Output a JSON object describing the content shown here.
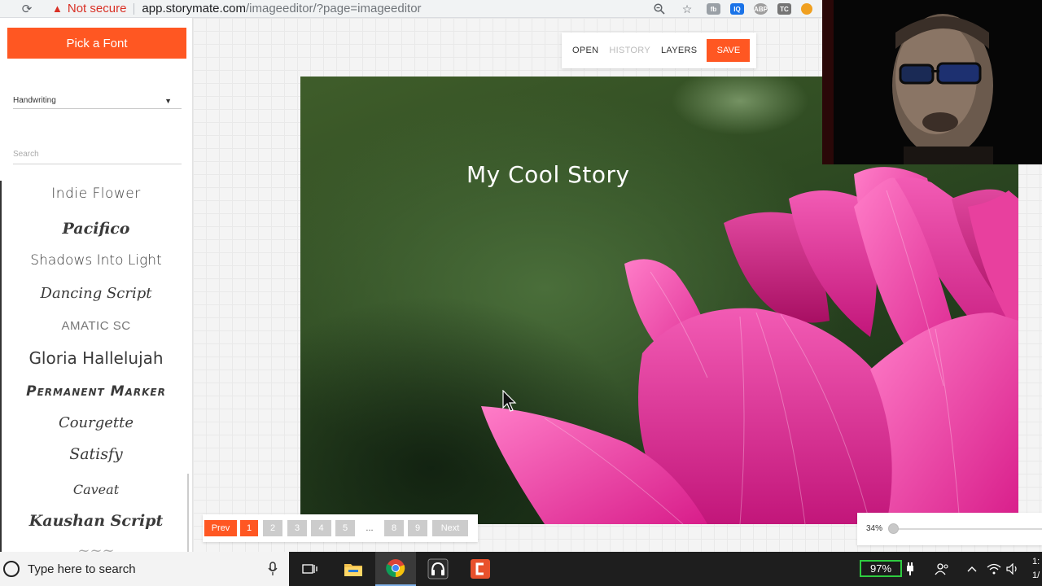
{
  "browser": {
    "security_label": "Not secure",
    "url_host": "app.storymate.com",
    "url_path": "/imageeditor/?page=imageeditor",
    "extensions": [
      "fb",
      "IQ",
      "ABP",
      "TC"
    ]
  },
  "sidebar": {
    "pick_font_label": "Pick a Font",
    "category_value": "Handwriting",
    "search_placeholder": "Search",
    "fonts": [
      {
        "label": "Indie Flower"
      },
      {
        "label": "Pacifico"
      },
      {
        "label": "Shadows Into Light"
      },
      {
        "label": "Dancing Script"
      },
      {
        "label": "AMATIC SC"
      },
      {
        "label": "Gloria Hallelujah"
      },
      {
        "label": "Permanent Marker"
      },
      {
        "label": "Courgette"
      },
      {
        "label": "Satisfy"
      },
      {
        "label": "Caveat"
      },
      {
        "label": "Kaushan Script"
      }
    ]
  },
  "toolbar": {
    "open_label": "OPEN",
    "history_label": "HISTORY",
    "layers_label": "LAYERS",
    "save_label": "SAVE"
  },
  "canvas": {
    "title_text": "My Cool Story"
  },
  "pagination": {
    "prev_label": "Prev",
    "pages": [
      "1",
      "2",
      "3",
      "4",
      "5",
      "...",
      "8",
      "9"
    ],
    "current_page": "1",
    "next_label": "Next"
  },
  "zoom": {
    "label": "34%",
    "value_percent": 34
  },
  "taskbar": {
    "search_placeholder": "Type here to search",
    "battery_label": "97%",
    "clock_time": "1:",
    "clock_date": "1/"
  },
  "colors": {
    "accent": "#ff5722",
    "page_inactive": "#cccccc",
    "battery_border": "#2ecc40"
  }
}
